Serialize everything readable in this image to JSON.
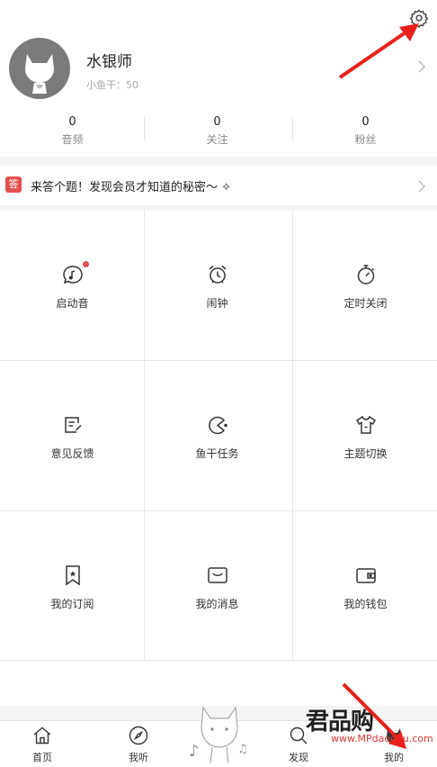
{
  "profile": {
    "username": "水银师",
    "fish_label": "小鱼干：50",
    "stats": [
      {
        "value": "0",
        "label": "音频"
      },
      {
        "value": "0",
        "label": "关注"
      },
      {
        "value": "0",
        "label": "粉丝"
      }
    ]
  },
  "quiz": {
    "badge": "答",
    "text": "来答个题！发现会员才知道的秘密～ ✧"
  },
  "grid": [
    {
      "label": "启动音",
      "icon": "chat-music-icon"
    },
    {
      "label": "闹钟",
      "icon": "alarm-clock-icon"
    },
    {
      "label": "定时关闭",
      "icon": "timer-icon"
    },
    {
      "label": "意见反馈",
      "icon": "feedback-edit-icon"
    },
    {
      "label": "鱼干任务",
      "icon": "pacman-icon"
    },
    {
      "label": "主题切换",
      "icon": "tshirt-icon"
    },
    {
      "label": "我的订阅",
      "icon": "bookmark-star-icon"
    },
    {
      "label": "我的消息",
      "icon": "message-box-icon"
    },
    {
      "label": "我的钱包",
      "icon": "wallet-icon"
    }
  ],
  "tabs": [
    {
      "label": "首页"
    },
    {
      "label": "我听"
    },
    {
      "label": "发现"
    },
    {
      "label": "我的"
    }
  ],
  "watermark": {
    "brand": "君品购",
    "url": "www.MPdaogou.com"
  },
  "colors": {
    "accent_red": "#e0514f",
    "arrow_red": "#e8201b"
  }
}
